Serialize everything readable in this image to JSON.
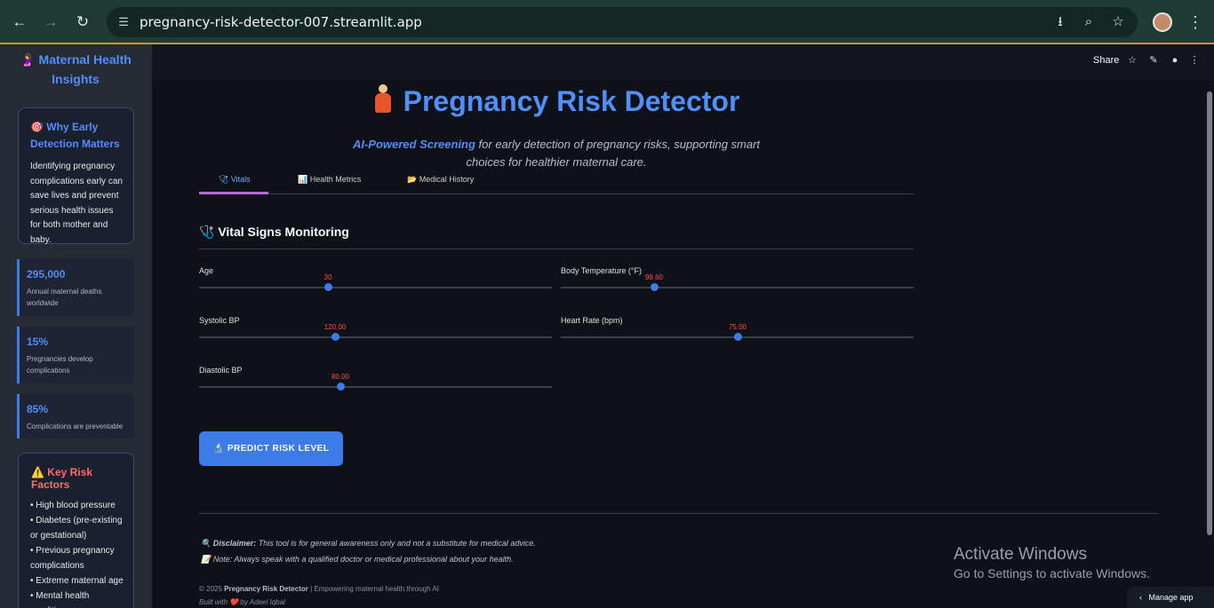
{
  "browser": {
    "url": "pregnancy-risk-detector-007.streamlit.app",
    "back_icon": "←",
    "forward_icon": "→",
    "reload_icon": "↻",
    "tune_icon": "☰",
    "install_icon": "⭳",
    "zoom_icon": "⌕",
    "bookmark_icon": "☆",
    "menu_icon": "⋮"
  },
  "sidebar": {
    "title_icon": "🤰",
    "title": "Maternal Health Insights",
    "why": {
      "icon": "🎯",
      "title": "Why Early Detection Matters",
      "body": "Identifying pregnancy complications early can save lives and prevent serious health issues for both mother and baby."
    },
    "stats": [
      {
        "value": "295,000",
        "label": "Annual maternal deaths worldwide"
      },
      {
        "value": "15%",
        "label": "Pregnancies develop complications"
      },
      {
        "value": "85%",
        "label": "Complications are preventable"
      }
    ],
    "risk": {
      "icon": "⚠️",
      "title": "Key Risk Factors",
      "items": [
        "• High blood pressure",
        "• Diabetes (pre-existing or gestational)",
        "• Previous pregnancy complications",
        "• Extreme maternal age",
        "• Mental health conditions"
      ]
    }
  },
  "topbar": {
    "share": "Share",
    "star_icon": "☆",
    "edit_icon": "✎",
    "github_icon": "●",
    "more_icon": "⋮"
  },
  "main": {
    "title": "Pregnancy Risk Detector",
    "subtitle_highlight": "AI-Powered Screening",
    "subtitle_rest": " for early detection of pregnancy risks, supporting smart choices for healthier maternal care.",
    "tabs": [
      {
        "icon": "🩺",
        "label": "Vitals"
      },
      {
        "icon": "📊",
        "label": "Health Metrics"
      },
      {
        "icon": "📂",
        "label": "Medical History"
      }
    ],
    "section_icon": "🩺",
    "section_title": "Vital Signs Monitoring",
    "sliders": {
      "age": {
        "label": "Age",
        "value": "30",
        "fraction": 0.365
      },
      "temp": {
        "label": "Body Temperature (°F)",
        "value": "98.60",
        "fraction": 0.265
      },
      "systolic": {
        "label": "Systolic BP",
        "value": "120.00",
        "fraction": 0.385
      },
      "heart": {
        "label": "Heart Rate (bpm)",
        "value": "75.00",
        "fraction": 0.5
      },
      "diastolic": {
        "label": "Diastolic BP",
        "value": "80.00",
        "fraction": 0.4
      }
    },
    "predict_icon": "🔬",
    "predict_label": "PREDICT RISK LEVEL",
    "disclaimer_icon": "🔍",
    "disclaimer_bold": "Disclaimer:",
    "disclaimer_text": " This tool is for general awareness only and not a substitute for medical advice.",
    "note_icon": "📝",
    "note_text": "Note: Always speak with a qualified doctor or medical professional about your health.",
    "copyright_prefix": "© 2025 ",
    "copyright_bold": "Pregnancy Risk Detector",
    "copyright_rest": " | Empowering maternal health through AI",
    "built_prefix": "Built with ",
    "built_heart": "❤️",
    "built_rest": " by Adeel Iqbal"
  },
  "overlay": {
    "activate_title": "Activate Windows",
    "activate_sub": "Go to Settings to activate Windows.",
    "manage_icon": "‹",
    "manage_label": "Manage app"
  },
  "colors": {
    "accent": "#4f8ff7",
    "button": "#3d7be8",
    "slider_value": "#ff4b4b",
    "risk_title": "#ff6b6b"
  }
}
